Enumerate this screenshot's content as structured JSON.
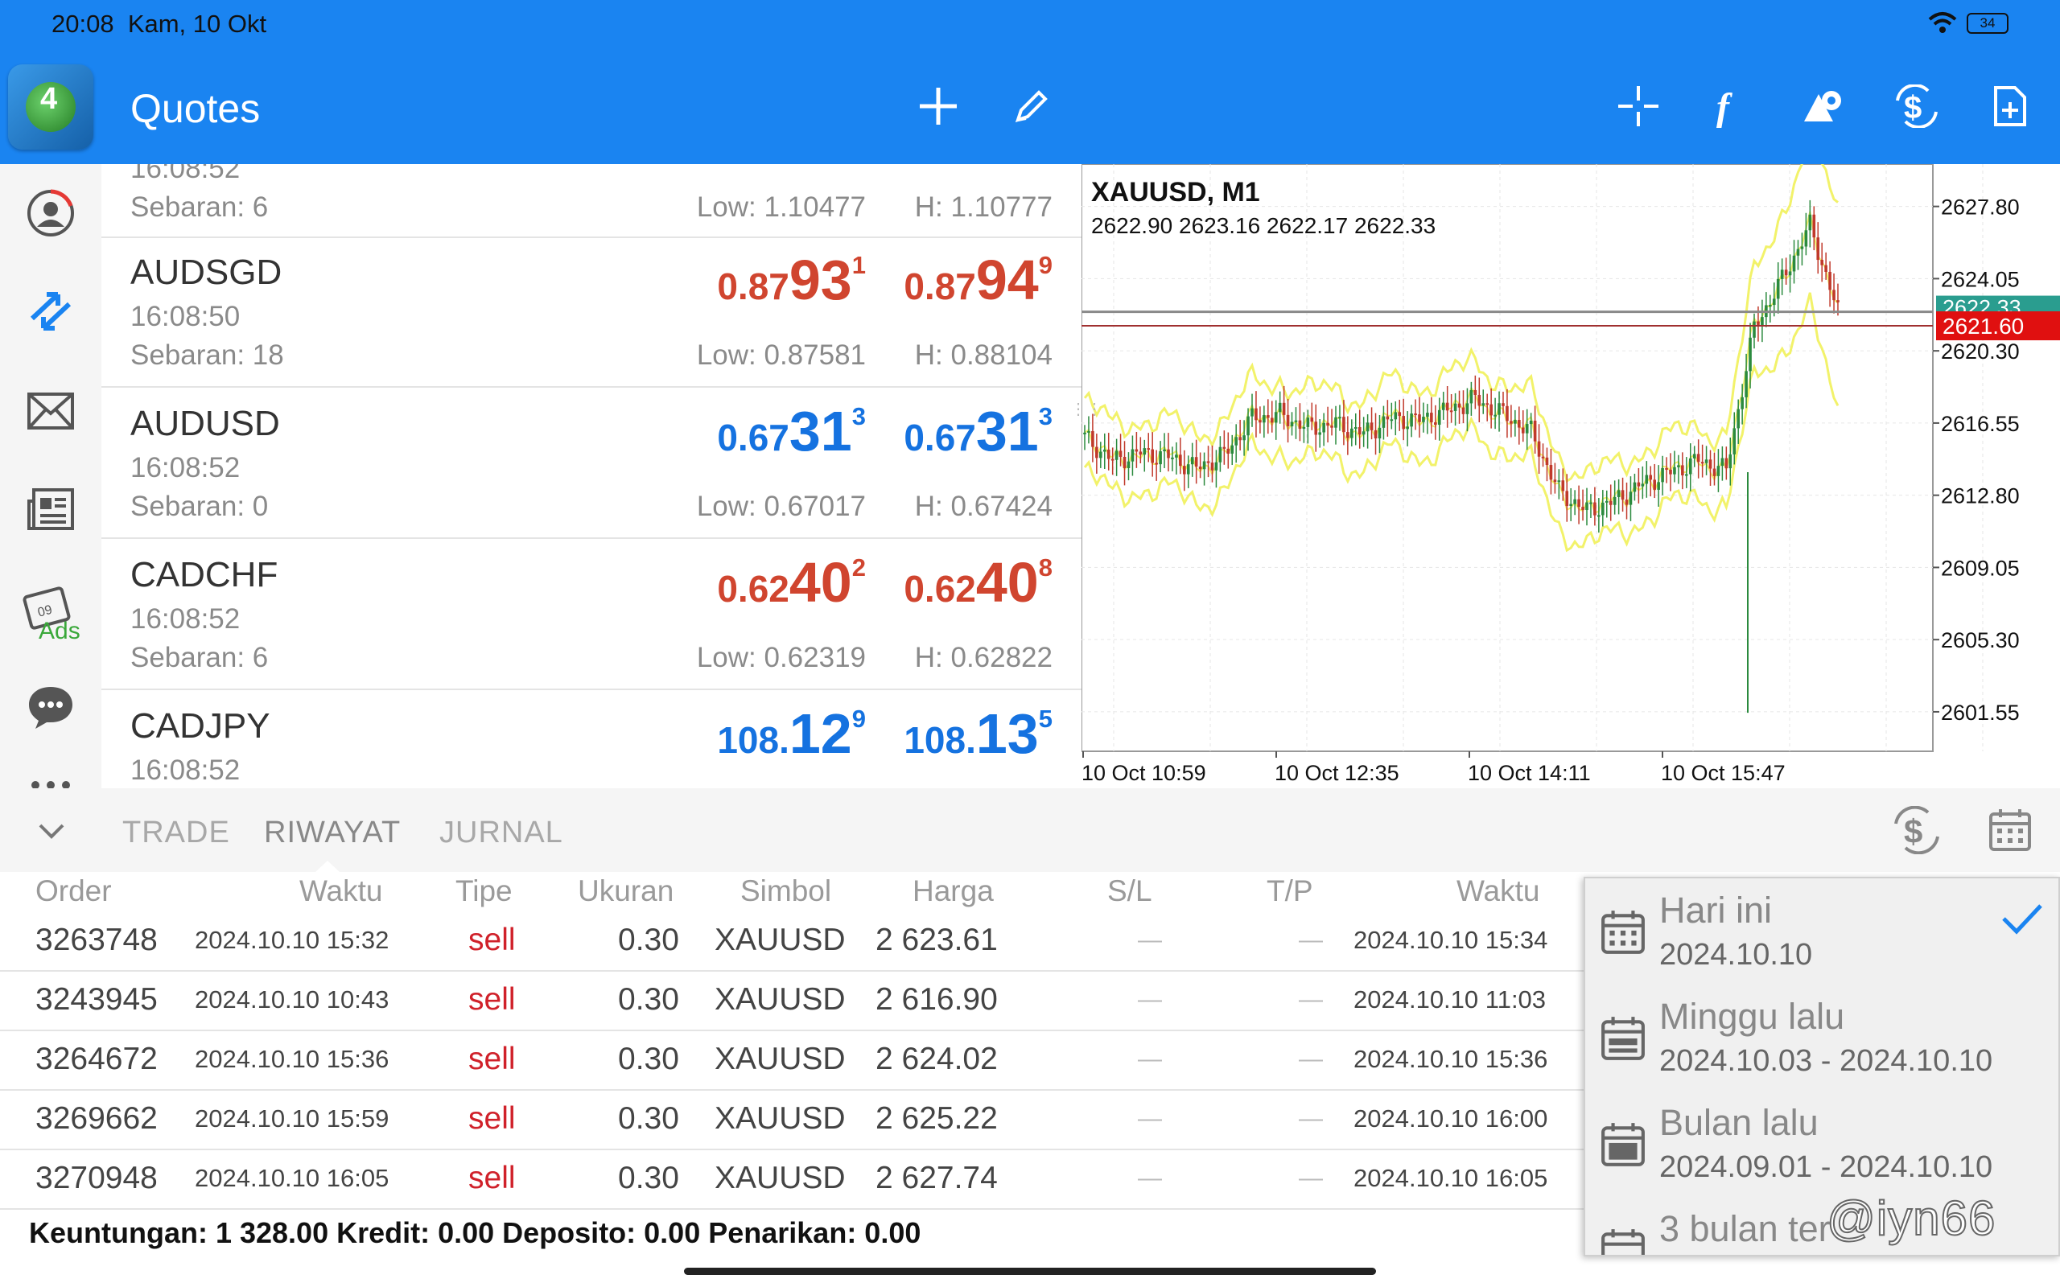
{
  "status_bar": {
    "time": "20:08",
    "date": "Kam, 10 Okt",
    "battery": "34"
  },
  "app_bar": {
    "title": "Quotes",
    "icons": [
      "app-logo-icon",
      "add-icon",
      "edit-pencil-icon",
      "crosshair-icon",
      "function-icon",
      "shapes-icon",
      "dollar-refresh-icon",
      "new-document-icon"
    ]
  },
  "sidebar": {
    "icons": [
      "account-icon",
      "trade-arrows-icon",
      "mail-icon",
      "news-icon",
      "calendar-ads-icon",
      "chat-icon",
      "more-icon"
    ],
    "ads_label": "Ads"
  },
  "quotes": {
    "partial_top": {
      "time": "16:08:52",
      "spread": "Sebaran: 6",
      "low": "Low: 1.10477",
      "high": "H: 1.10777"
    },
    "rows": [
      {
        "symbol": "AUDSGD",
        "time": "16:08:50",
        "spread": "Sebaran: 18",
        "bid": {
          "small": "0.87",
          "big": "93",
          "pip": "1"
        },
        "ask": {
          "small": "0.87",
          "big": "94",
          "pip": "9"
        },
        "low": "Low: 0.87581",
        "high": "H: 0.88104",
        "color": "#d0452f"
      },
      {
        "symbol": "AUDUSD",
        "time": "16:08:52",
        "spread": "Sebaran: 0",
        "bid": {
          "small": "0.67",
          "big": "31",
          "pip": "3"
        },
        "ask": {
          "small": "0.67",
          "big": "31",
          "pip": "3"
        },
        "low": "Low: 0.67017",
        "high": "H: 0.67424",
        "color": "#1572e0"
      },
      {
        "symbol": "CADCHF",
        "time": "16:08:52",
        "spread": "Sebaran: 6",
        "bid": {
          "small": "0.62",
          "big": "40",
          "pip": "2"
        },
        "ask": {
          "small": "0.62",
          "big": "40",
          "pip": "8"
        },
        "low": "Low: 0.62319",
        "high": "H: 0.62822",
        "color": "#d0452f"
      },
      {
        "symbol": "CADJPY",
        "time": "16:08:52",
        "spread": "",
        "bid": {
          "small": "108.",
          "big": "12",
          "pip": "9"
        },
        "ask": {
          "small": "108.",
          "big": "13",
          "pip": "5"
        },
        "low": "",
        "high": "",
        "color": "#1572e0"
      }
    ]
  },
  "chart": {
    "title": "XAUUSD, M1",
    "ohlc": "2622.90 2623.16 2622.17 2622.33",
    "price_labels": [
      "2627.80",
      "2624.05",
      "2620.30",
      "2616.55",
      "2612.80",
      "2609.05",
      "2605.30",
      "2601.55"
    ],
    "current_price": "2621.60",
    "bid_price_hidden": "2622.33",
    "time_labels": [
      "10 Oct 10:59",
      "10 Oct 12:35",
      "10 Oct 14:11",
      "10 Oct 15:47"
    ]
  },
  "chart_data": {
    "type": "line",
    "title": "XAUUSD, M1",
    "x": [
      "10 Oct 10:59",
      "10 Oct 12:35",
      "10 Oct 14:11",
      "10 Oct 15:47"
    ],
    "ylim": [
      2599.5,
      2630.0
    ],
    "grid": true,
    "series": [
      {
        "values": [
          2615.8,
          2614.6,
          2615.0,
          2614.8,
          2614.2,
          2614.9,
          2616.8,
          2617.0,
          2616.3,
          2616.5,
          2616.0,
          2616.8,
          2616.7,
          2617.2,
          2617.8,
          2617.0,
          2616.1,
          2613.0,
          2612.0,
          2612.5,
          2613.4,
          2614.0,
          2614.6,
          2614.1,
          2621.5,
          2624.0,
          2626.8,
          2622.33
        ]
      }
    ]
  },
  "bottom_panel": {
    "tabs": [
      "TRADE",
      "RIWAYAT",
      "JURNAL"
    ],
    "columns": [
      "Order",
      "Waktu",
      "Tipe",
      "Ukuran",
      "Simbol",
      "Harga",
      "S/L",
      "T/P",
      "Waktu"
    ],
    "rows": [
      [
        "3263748",
        "2024.10.10 15:32",
        "sell",
        "0.30",
        "XAUUSD",
        "2 623.61",
        "—",
        "—",
        "2024.10.10 15:34"
      ],
      [
        "3243945",
        "2024.10.10 10:43",
        "sell",
        "0.30",
        "XAUUSD",
        "2 616.90",
        "—",
        "—",
        "2024.10.10 11:03"
      ],
      [
        "3264672",
        "2024.10.10 15:36",
        "sell",
        "0.30",
        "XAUUSD",
        "2 624.02",
        "—",
        "—",
        "2024.10.10 15:36"
      ],
      [
        "3269662",
        "2024.10.10 15:59",
        "sell",
        "0.30",
        "XAUUSD",
        "2 625.22",
        "—",
        "—",
        "2024.10.10 16:00"
      ],
      [
        "3270948",
        "2024.10.10 16:05",
        "sell",
        "0.30",
        "XAUUSD",
        "2 627.74",
        "—",
        "—",
        "2024.10.10 16:05"
      ]
    ],
    "totals": "Keuntungan: 1 328.00  Kredit: 0.00  Deposito: 0.00  Penarikan: 0.00"
  },
  "period_menu": [
    {
      "title": "Hari ini",
      "range": "2024.10.10",
      "selected": true
    },
    {
      "title": "Minggu lalu",
      "range": "2024.10.03 - 2024.10.10",
      "selected": false
    },
    {
      "title": "Bulan lalu",
      "range": "2024.09.01 - 2024.10.10",
      "selected": false
    },
    {
      "title": "3 bulan ter",
      "range": "",
      "selected": false
    }
  ],
  "watermark": "@iyn66"
}
